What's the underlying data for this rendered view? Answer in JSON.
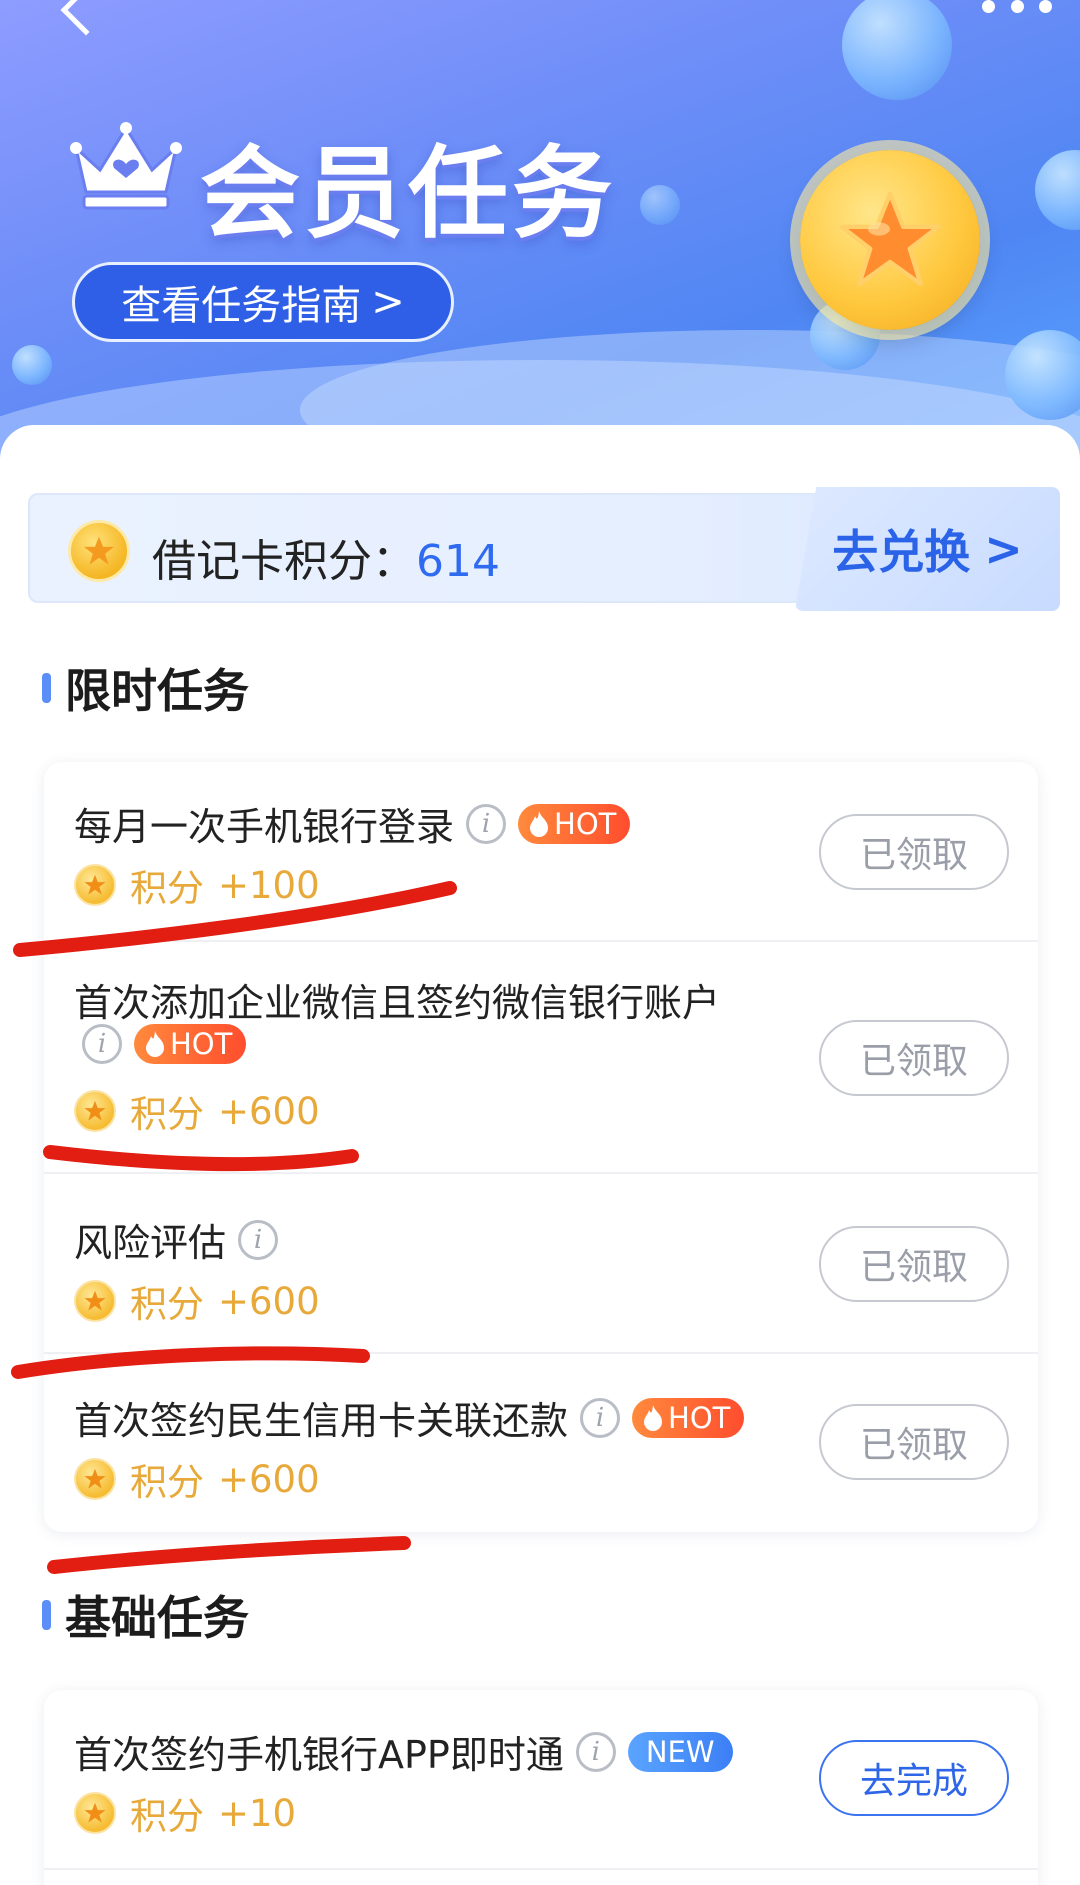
{
  "header": {
    "title": "会员任务",
    "guide_label": "查看任务指南",
    "guide_arrow": ">"
  },
  "points": {
    "label": "借记卡积分：",
    "value": "614",
    "exchange_label": "去兑换",
    "exchange_arrow": ">"
  },
  "limited": {
    "section_title": "限时任务",
    "tasks": [
      {
        "title": "每月一次手机银行登录",
        "badge": "HOT",
        "reward_label": "积分",
        "reward_value": "+100",
        "action": "已领取"
      },
      {
        "title": "首次添加企业微信且签约微信银行账户",
        "badge": "HOT",
        "reward_label": "积分",
        "reward_value": "+600",
        "action": "已领取"
      },
      {
        "title": "风险评估",
        "badge": "",
        "reward_label": "积分",
        "reward_value": "+600",
        "action": "已领取"
      },
      {
        "title": "首次签约民生信用卡关联还款",
        "badge": "HOT",
        "reward_label": "积分",
        "reward_value": "+600",
        "action": "已领取"
      }
    ]
  },
  "basic": {
    "section_title": "基础任务",
    "tasks": [
      {
        "title": "首次签约手机银行APP即时通",
        "badge": "NEW",
        "reward_label": "积分",
        "reward_value": "+10",
        "action": "去完成"
      }
    ]
  },
  "icons": {
    "back": "chevron-left-icon",
    "more": "more-dots-icon",
    "crown": "crown-icon",
    "coin": "star-coin-icon",
    "info": "info-icon",
    "flame": "flame-icon"
  },
  "colors": {
    "accent_blue": "#2f6bf0",
    "reward_gold": "#e7a93a",
    "hot_badge": "#ff5a30",
    "new_badge": "#4a90f7",
    "annotation_red": "#e21d12"
  }
}
